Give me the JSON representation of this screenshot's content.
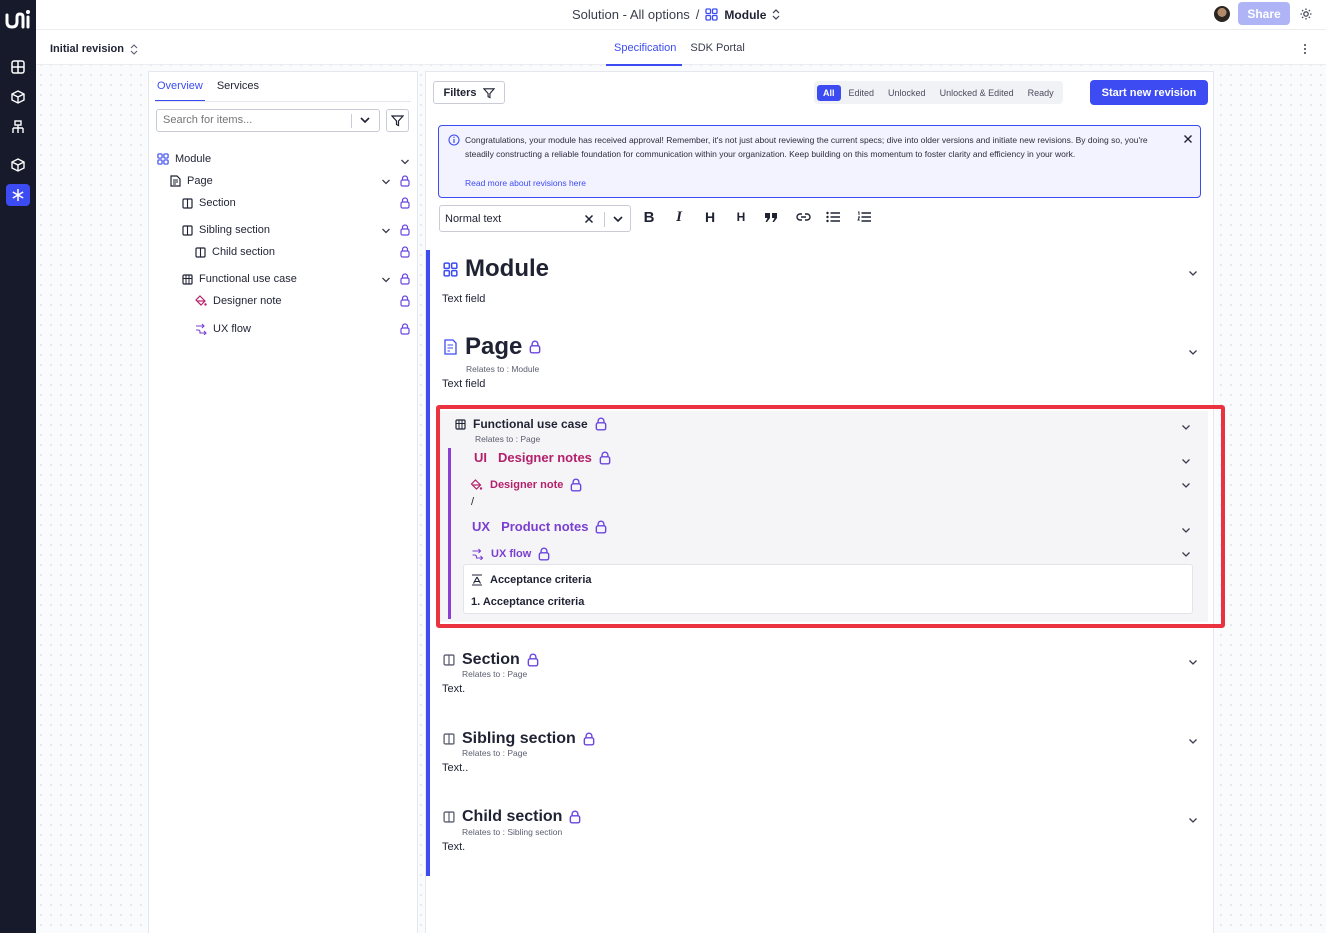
{
  "app": {
    "breadcrumb_solution": "Solution - All options",
    "breadcrumb_sep": "/",
    "breadcrumb_module": "Module",
    "share_label": "Share",
    "revision_label": "Initial revision",
    "tabs": [
      {
        "label": "Specification",
        "active": true
      },
      {
        "label": "SDK Portal",
        "active": false
      }
    ]
  },
  "rail": {
    "icons": [
      "logo",
      "grid-icon",
      "cube-icon",
      "hierarchy-icon",
      "box-icon",
      "asterisk-icon"
    ]
  },
  "sidebar": {
    "tabs": [
      {
        "label": "Overview",
        "active": true
      },
      {
        "label": "Services",
        "active": false
      }
    ],
    "search_placeholder": "Search for items...",
    "tree": [
      {
        "label": "Module",
        "icon": "module-icon",
        "locked": false,
        "expanded": true
      },
      {
        "label": "Page",
        "icon": "page-icon",
        "locked": true,
        "expanded": true
      },
      {
        "label": "Section",
        "icon": "section-icon",
        "locked": true
      },
      {
        "label": "Sibling section",
        "icon": "section-icon",
        "locked": true,
        "expanded": true
      },
      {
        "label": "Child section",
        "icon": "section-icon",
        "locked": true
      },
      {
        "label": "Functional use case",
        "icon": "use-case-icon",
        "locked": true,
        "expanded": true
      },
      {
        "label": "Designer note",
        "icon": "paint-bucket-icon",
        "locked": true
      },
      {
        "label": "UX flow",
        "icon": "flow-icon",
        "locked": true
      }
    ]
  },
  "content": {
    "filters_label": "Filters",
    "segments": [
      {
        "label": "All",
        "active": true
      },
      {
        "label": "Edited",
        "active": false
      },
      {
        "label": "Unlocked",
        "active": false
      },
      {
        "label": "Unlocked & Edited",
        "active": false
      },
      {
        "label": "Ready",
        "active": false
      }
    ],
    "start_revision_label": "Start new revision",
    "notice": {
      "message": "Congratulations, your module has received approval! Remember, it's not just about reviewing the current specs; dive into older versions and initiate new revisions. By doing so, you're steadily constructing a reliable foundation for communication within your organization. Keep building on this momentum to foster clarity and efficiency in your work.",
      "link": "Read more about revisions here"
    },
    "editor": {
      "text_style": "Normal text",
      "tools": [
        "B",
        "I",
        "H",
        "H",
        "quote",
        "link",
        "bullet-list",
        "numbered-list"
      ]
    },
    "sections": {
      "module": {
        "title": "Module",
        "text": "Text field"
      },
      "page": {
        "title": "Page",
        "relates": "Relates to : Module",
        "text": "Text field"
      },
      "fuc": {
        "title": "Functional use case",
        "relates": "Relates to : Page",
        "ui_prefix": "UI",
        "designer_notes": "Designer notes",
        "designer_note": "Designer note",
        "designer_note_text": "/",
        "ux_prefix": "UX",
        "product_notes": "Product notes",
        "ux_flow": "UX flow",
        "acceptance_title": "Acceptance criteria",
        "acceptance_item": "1.  Acceptance criteria"
      },
      "section": {
        "title": "Section",
        "relates": "Relates to : Page",
        "text": "Text."
      },
      "sibling": {
        "title": "Sibling section",
        "relates": "Relates to : Page",
        "text": "Text.."
      },
      "child": {
        "title": "Child section",
        "relates": "Relates to : Sibling section",
        "text": "Text."
      }
    }
  },
  "colors": {
    "accent": "#3d4cf2",
    "rail": "#161a2b",
    "designer": "#b3206b",
    "ux": "#7a3fd0",
    "highlight": "#ea3241"
  }
}
